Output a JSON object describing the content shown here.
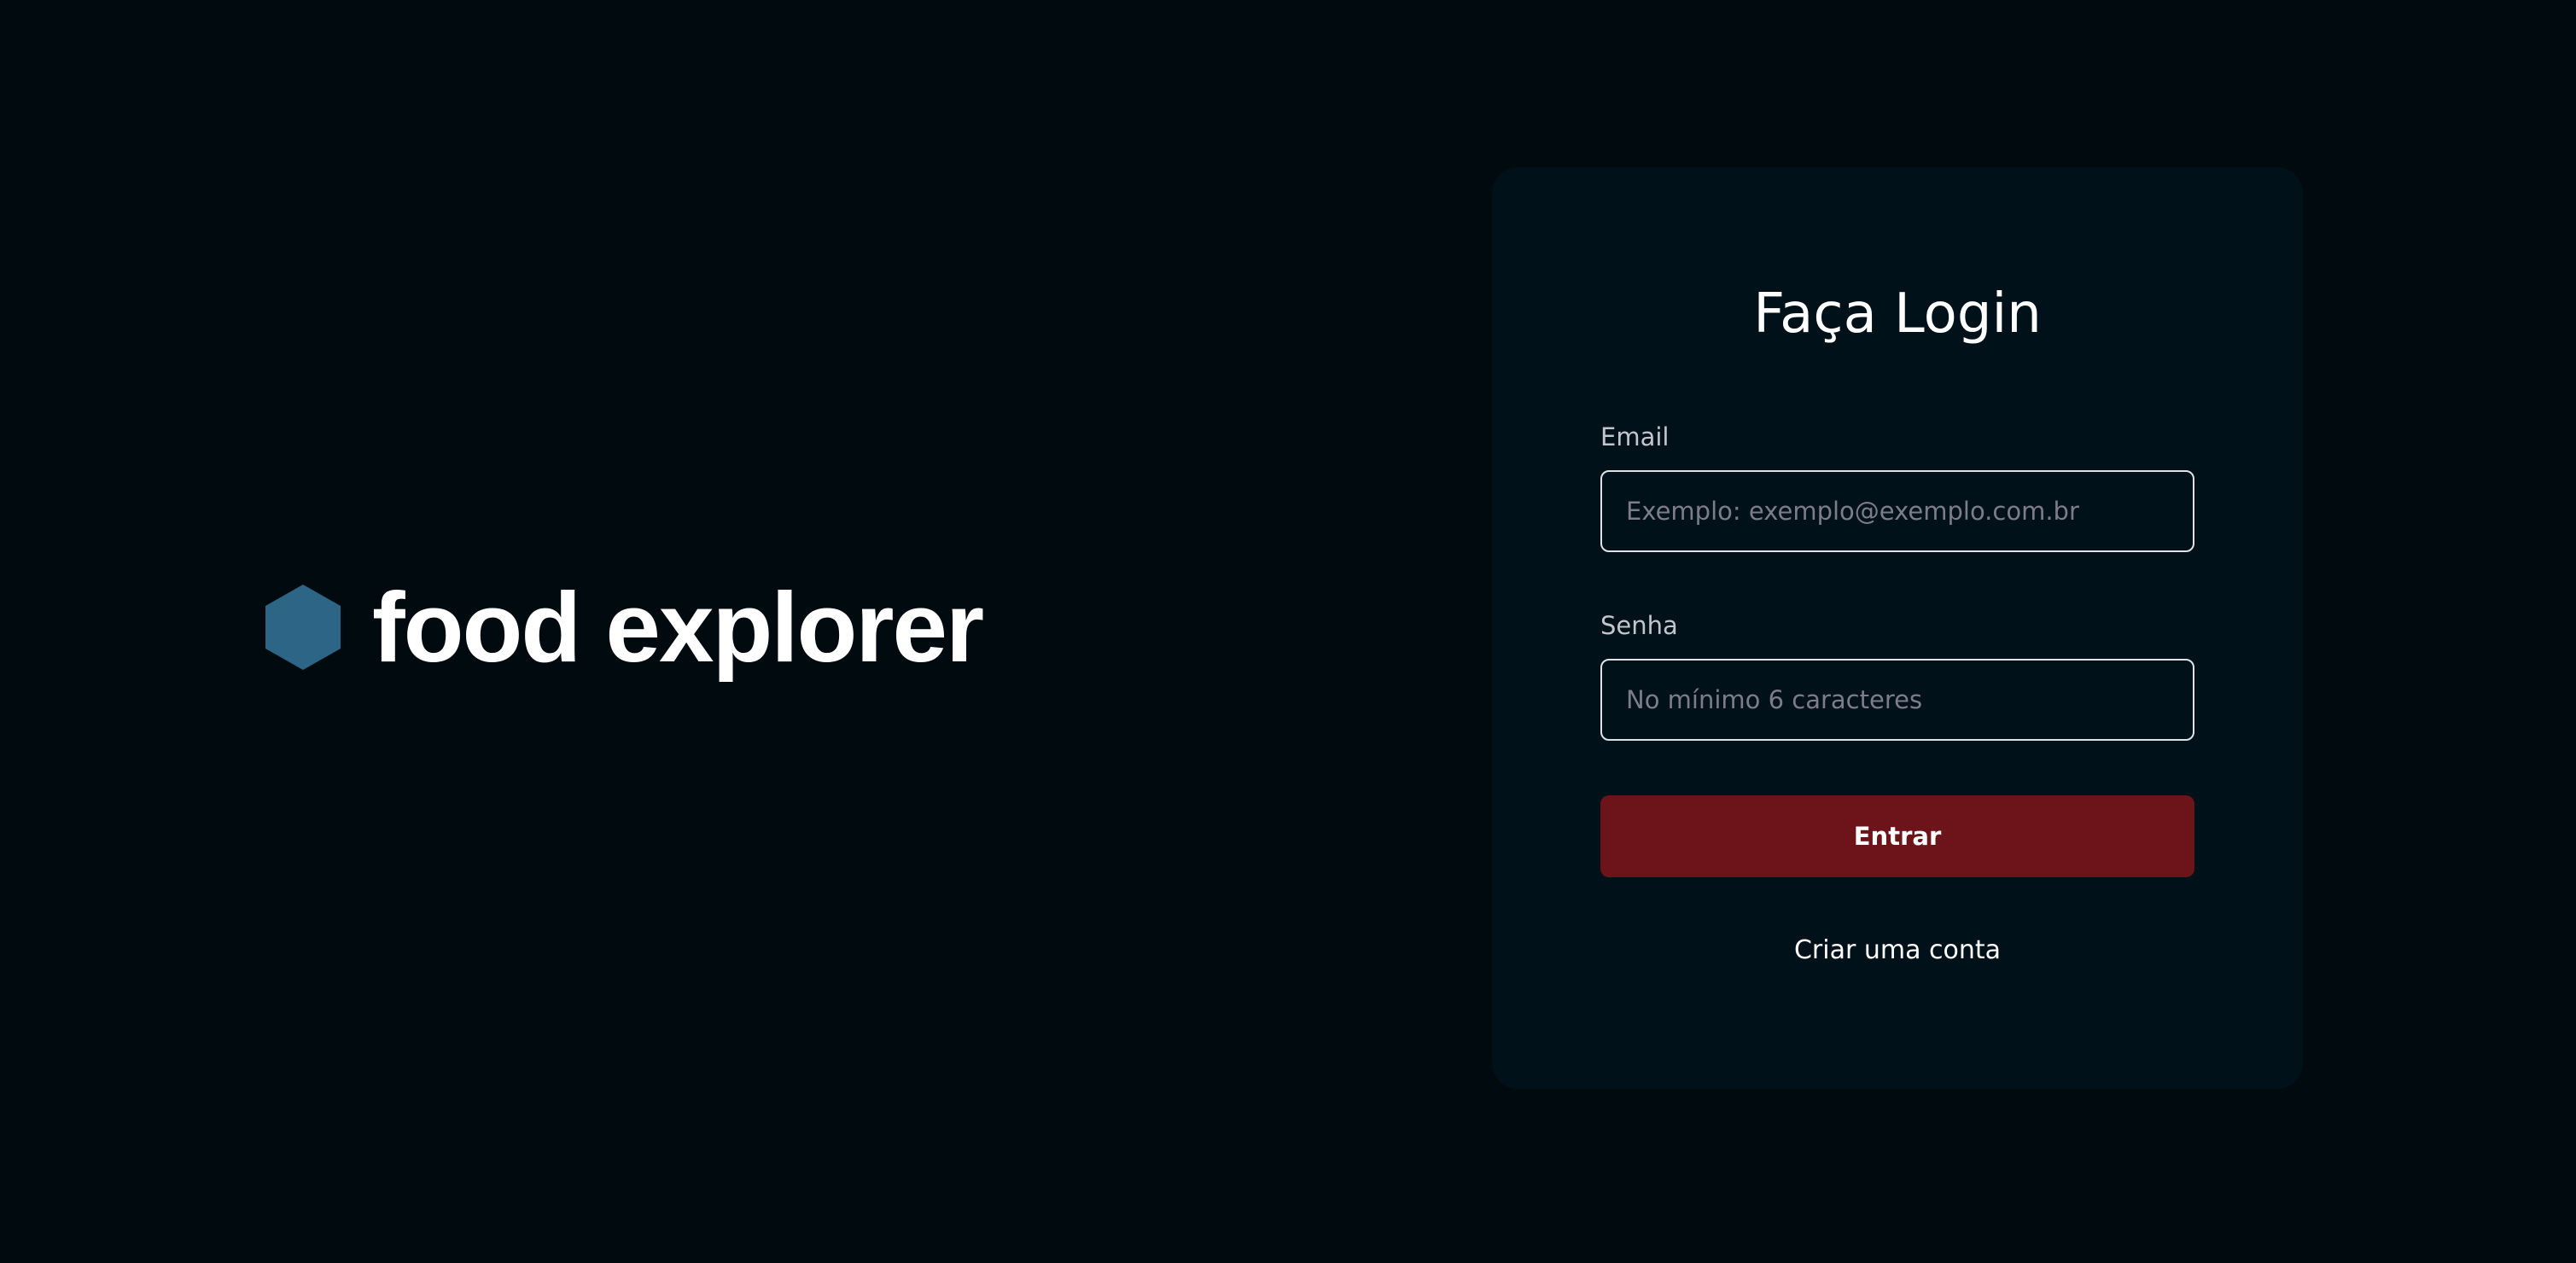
{
  "colors": {
    "background": "#000a0f",
    "card": "#001119",
    "brand_icon": "#065e7c",
    "button": "#6c1419",
    "input_border": "#e1e1e6",
    "placeholder": "#7c7c8a"
  },
  "brand": {
    "icon": "hexagon-icon",
    "name": "food explorer"
  },
  "login": {
    "title": "Faça Login",
    "email": {
      "label": "Email",
      "placeholder": "Exemplo: exemplo@exemplo.com.br",
      "value": ""
    },
    "password": {
      "label": "Senha",
      "placeholder": "No mínimo 6 caracteres",
      "value": ""
    },
    "submit_label": "Entrar",
    "create_account_label": "Criar uma conta"
  }
}
